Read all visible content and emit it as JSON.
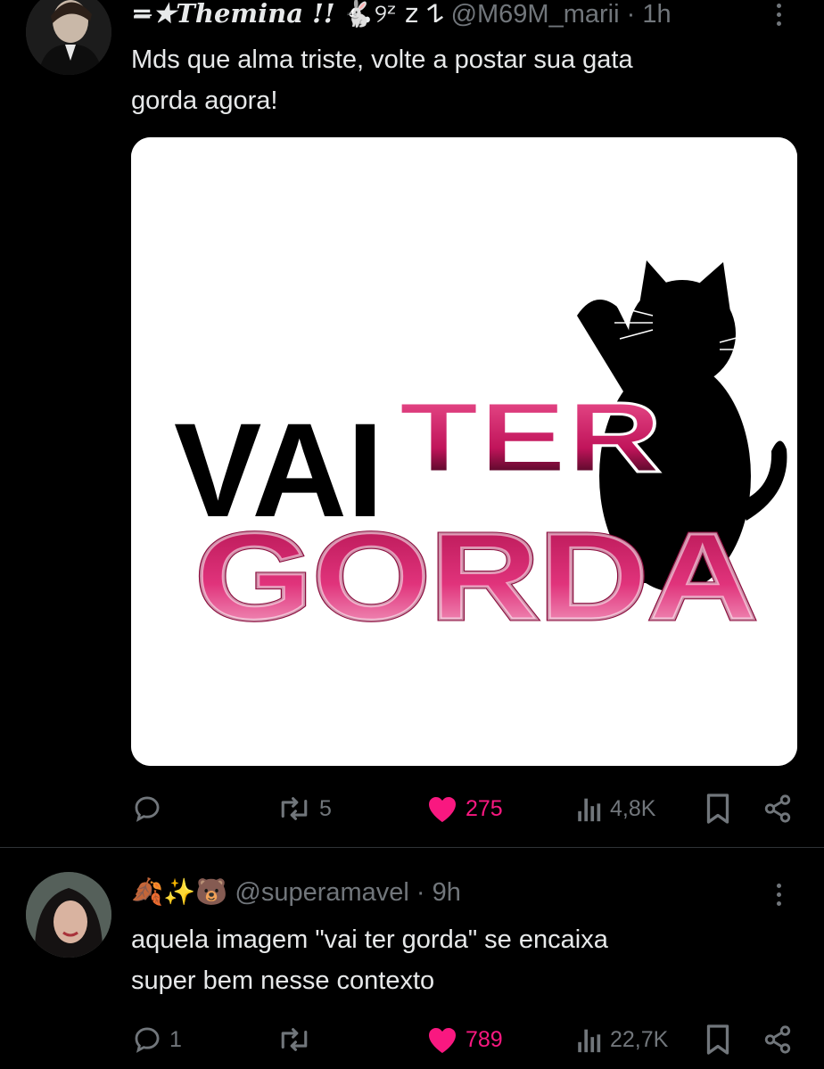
{
  "tweet1": {
    "display_name": "=̶★Themina !!",
    "name_emoji": "🐇୨ᶻ z 𐰁",
    "handle": "@M69M_marii",
    "time": "· 1h",
    "text_line1": "Mds que alma triste, volte a postar sua gata",
    "text_line2": "gorda agora!",
    "image": {
      "word1": "VAI",
      "word2": "TER",
      "word3": "GORDA",
      "colors": {
        "black_text": "#000000",
        "pink": "#d81e6a",
        "pink_light": "#f4a6c8"
      }
    },
    "actions": {
      "replies": "",
      "reposts": "5",
      "likes": "275",
      "views": "4,8K",
      "liked": true
    }
  },
  "tweet2": {
    "name_emoji": "🍂✨🐻",
    "handle": "@superamavel",
    "time": "· 9h",
    "text_line1": "aquela imagem \"vai ter gorda\" se encaixa",
    "text_line2": "super bem nesse contexto",
    "actions": {
      "replies": "1",
      "reposts": "",
      "likes": "789",
      "views": "22,7K",
      "liked": true
    }
  },
  "colors": {
    "background": "#000000",
    "text": "#e7e9ea",
    "secondary": "#71767b",
    "like": "#f91880",
    "divider": "#2f3336"
  },
  "icons": [
    "reply-icon",
    "repost-icon",
    "like-icon",
    "views-icon",
    "bookmark-icon",
    "share-icon",
    "more-icon"
  ]
}
